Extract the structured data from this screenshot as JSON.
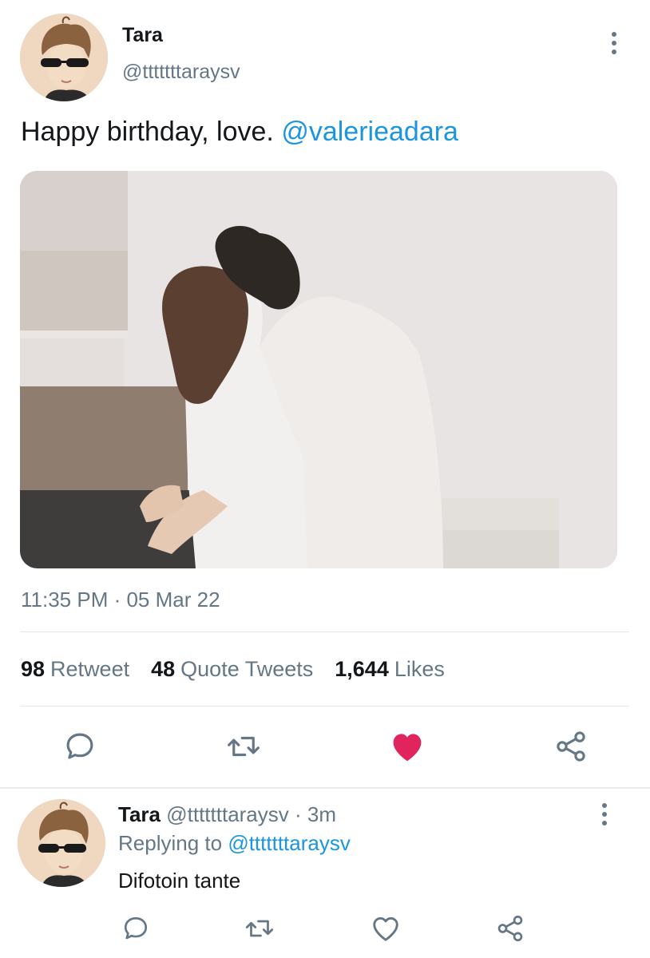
{
  "tweet": {
    "author_name": "Tara",
    "author_handle": "@tttttttaraysv",
    "text": "Happy birthday, love.",
    "mention": "@valerieadara",
    "timestamp": "11:35 PM · 05 Mar 22",
    "stats": {
      "retweets": "98",
      "retweets_label": "Retweet",
      "quotes": "48",
      "quotes_label": "Quote Tweets",
      "likes": "1,644",
      "likes_label": "Likes"
    },
    "actions": [
      "reply-icon",
      "retweet-icon",
      "heart-filled-icon",
      "share-icon"
    ],
    "liked": true
  },
  "reply": {
    "author_name": "Tara",
    "author_handle": "@tttttttaraysv",
    "age": "· 3m",
    "replying_prefix": "Replying to",
    "replying_to": "@tttttttaraysv",
    "text": "Difotoin tante",
    "actions": [
      "reply-icon",
      "retweet-icon",
      "heart-icon",
      "share-icon"
    ]
  },
  "colors": {
    "link": "#1b95e0",
    "secondary_text": "#657786",
    "like_active": "#e0245e",
    "divider": "#e1e8ed"
  }
}
